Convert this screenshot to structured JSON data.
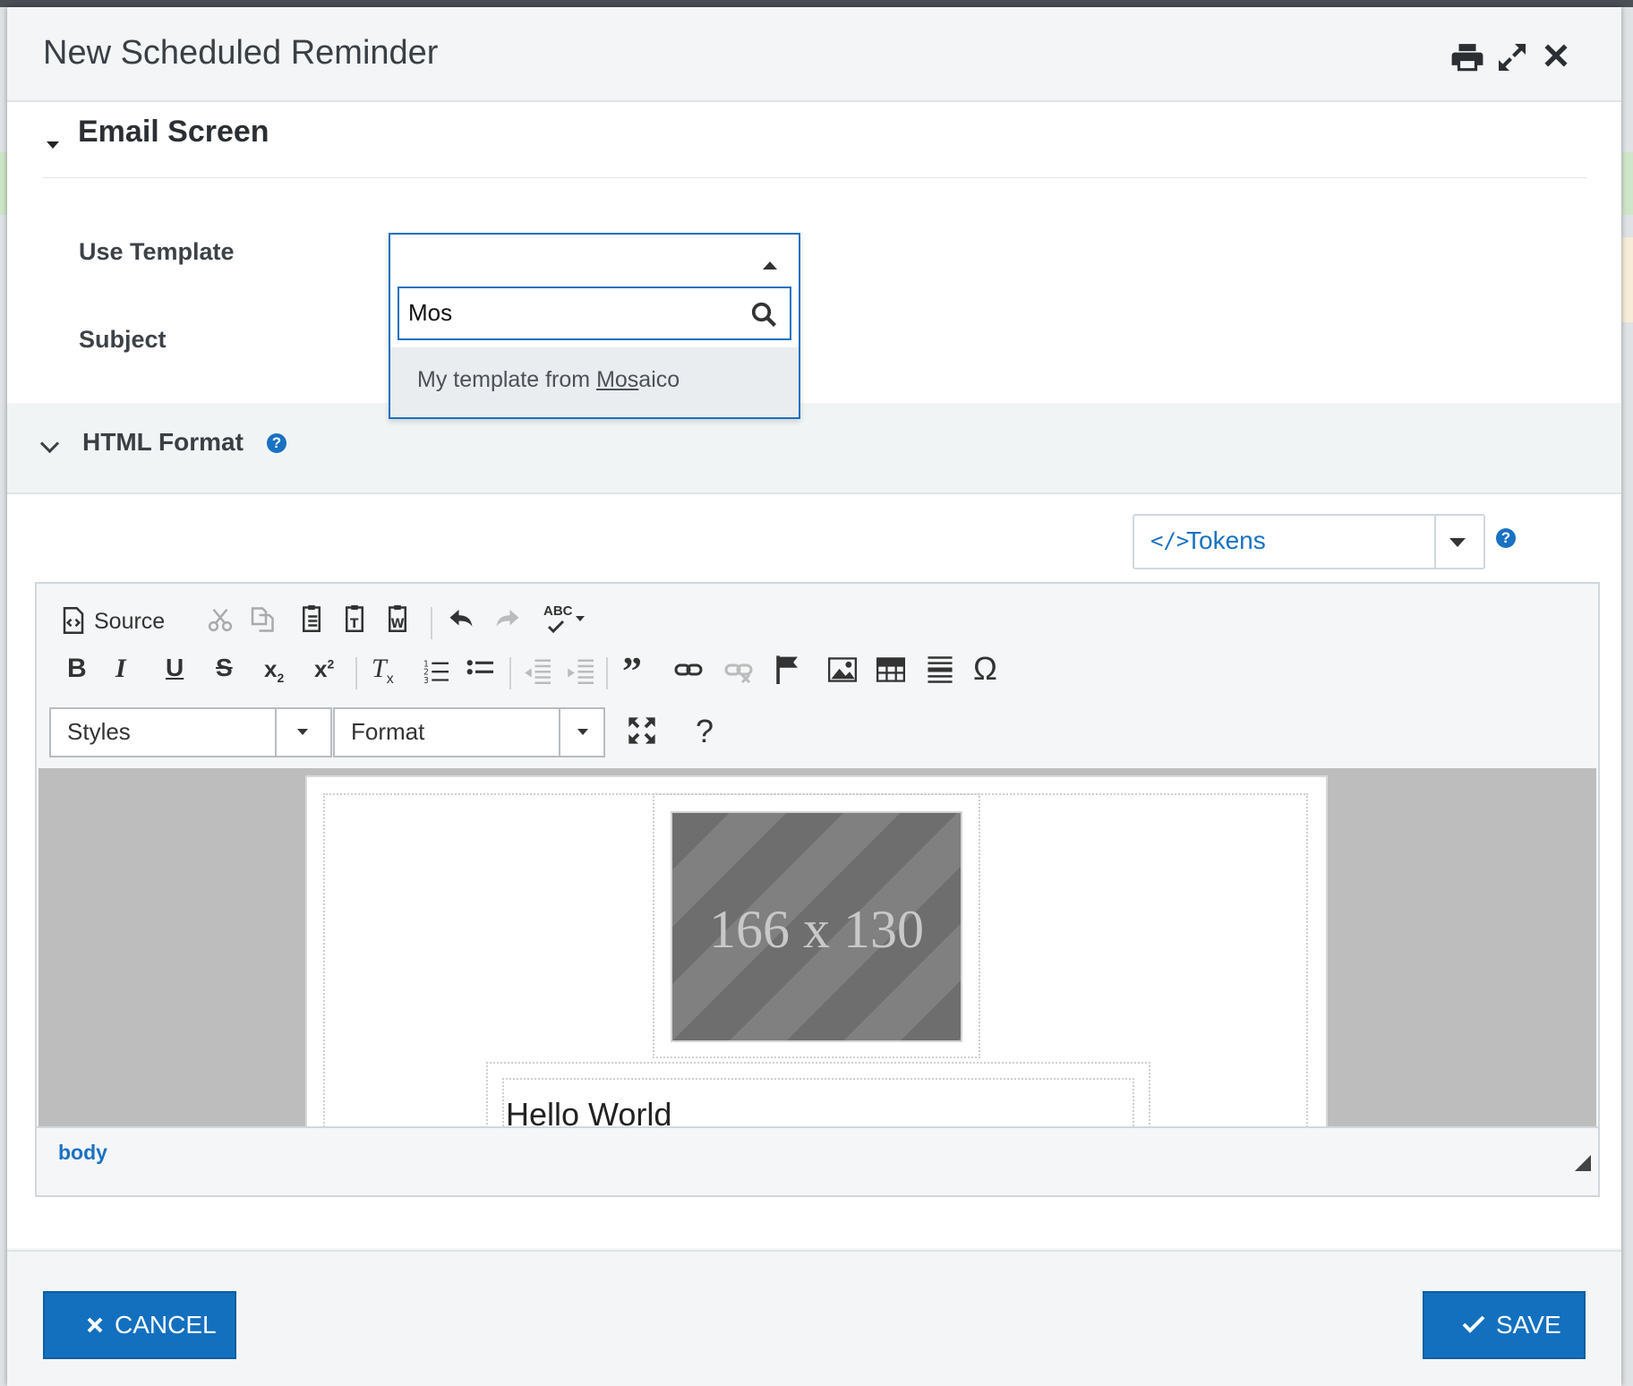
{
  "dialog": {
    "title": "New Scheduled Reminder",
    "header_icons": [
      "print-icon",
      "expand-icon",
      "close-icon"
    ]
  },
  "email_section": {
    "title": "Email Screen",
    "use_template_label": "Use Template",
    "subject_label": "Subject"
  },
  "template_dropdown": {
    "search_value": "Mos",
    "option_prefix": "My template from ",
    "option_match": "Mos",
    "option_suffix": "aico"
  },
  "html_format": {
    "label": "HTML Format",
    "help": "?"
  },
  "tokens": {
    "code_glyph": "</>",
    "label": "Tokens",
    "help": "?"
  },
  "editor": {
    "source_label": "Source",
    "styles_label": "Styles",
    "format_label": "Format",
    "help_glyph": "?",
    "spell_label": "ABC",
    "omega": "Ω",
    "image_placeholder": "166 x 130",
    "content_text": "Hello World",
    "status_path": "body"
  },
  "footer": {
    "cancel_label": "CANCEL",
    "save_label": "SAVE"
  },
  "colors": {
    "primary": "#1370bf",
    "link": "#1971c2"
  }
}
